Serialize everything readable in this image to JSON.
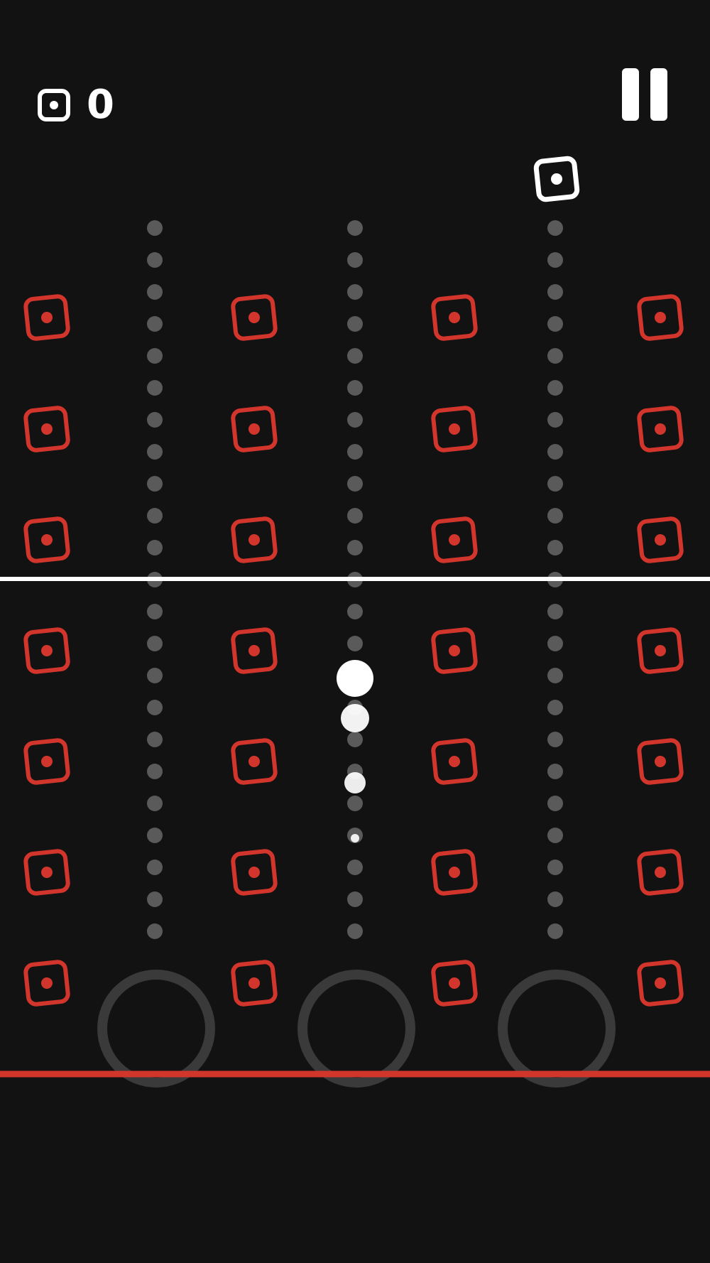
{
  "hud": {
    "coin_count": "0",
    "coin_icon": "coin-square-icon",
    "pause_icon": "pause-icon"
  },
  "colors": {
    "background": "#121212",
    "hazard": "#d2352c",
    "player": "#ffffff",
    "track_dot": "#5a5a5a",
    "ring": "#3a3a3a",
    "divider": "#ffffff"
  },
  "board": {
    "lanes": 3,
    "player_lane": 2,
    "hazard_columns": 4,
    "hazard_rows": 7,
    "collectibles": [
      {
        "lane": 3,
        "icon": "coin-square-icon"
      }
    ]
  }
}
